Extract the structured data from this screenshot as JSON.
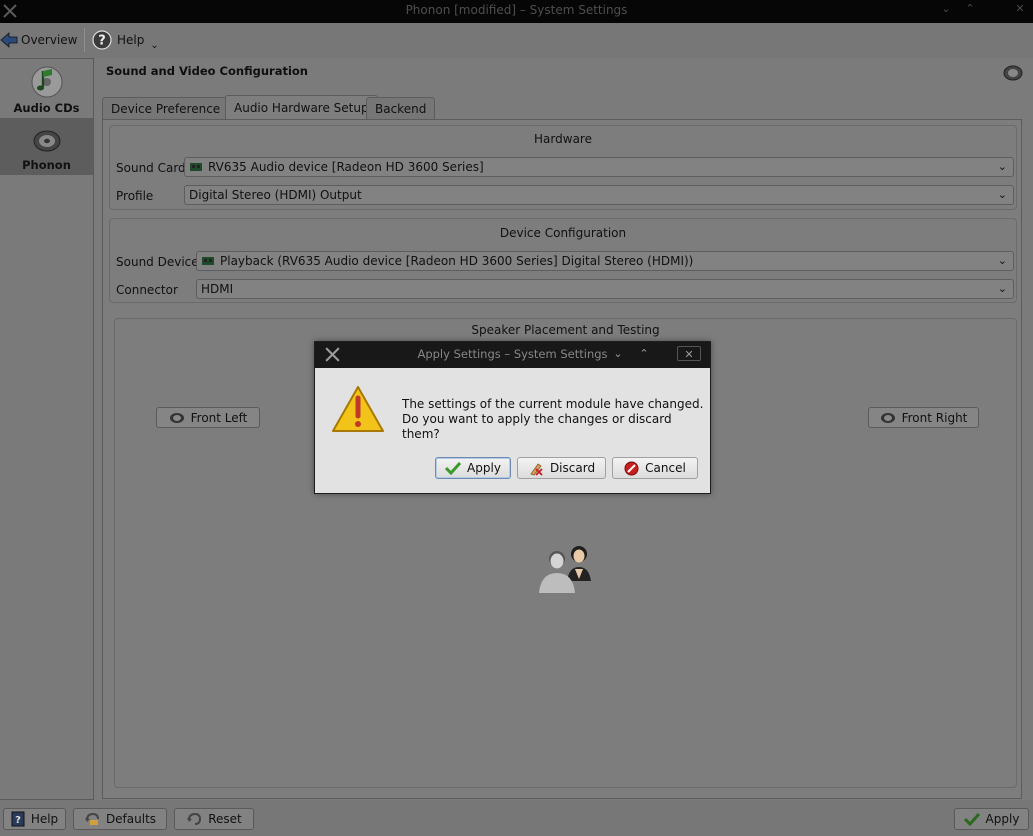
{
  "window": {
    "title": "Phonon [modified] – System Settings",
    "icon": "tools-icon",
    "controls": [
      "minimize-icon",
      "maximize-icon",
      "close-icon"
    ]
  },
  "toolbar": {
    "overview_label": "Overview",
    "help_label": "Help"
  },
  "sidebar": {
    "items": [
      {
        "label": "Audio CDs",
        "icon": "audio-cd-icon",
        "selected": false
      },
      {
        "label": "Phonon",
        "icon": "speaker-icon",
        "selected": true
      }
    ]
  },
  "module": {
    "title": "Sound and Video Configuration",
    "icon": "speaker-icon"
  },
  "tabs": [
    {
      "label": "Device Preference",
      "active": false
    },
    {
      "label": "Audio Hardware Setup",
      "active": true
    },
    {
      "label": "Backend",
      "active": false
    }
  ],
  "hardware": {
    "title": "Hardware",
    "sound_card_label": "Sound Card",
    "sound_card_value": "RV635 Audio device [Radeon HD 3600 Series]",
    "profile_label": "Profile",
    "profile_value": "Digital Stereo (HDMI) Output"
  },
  "device_config": {
    "title": "Device Configuration",
    "sound_device_label": "Sound Device",
    "sound_device_value": "Playback (RV635 Audio device [Radeon HD 3600 Series] Digital Stereo (HDMI))",
    "connector_label": "Connector",
    "connector_value": "HDMI"
  },
  "speaker": {
    "title": "Speaker Placement and Testing",
    "front_left": "Front Left",
    "front_right": "Front Right",
    "listener_icon": "users-icon"
  },
  "dialog": {
    "title": "Apply Settings – System Settings",
    "message_line1": "The settings of the current module have changed.",
    "message_line2": "Do you want to apply the changes or discard them?",
    "apply_label": "Apply",
    "discard_label": "Discard",
    "cancel_label": "Cancel",
    "icon": "warning-icon"
  },
  "bottombar": {
    "help_label": "Help",
    "defaults_label": "Defaults",
    "reset_label": "Reset",
    "apply_label": "Apply"
  },
  "colors": {
    "background": "#7b7b7b",
    "dialog_bg": "#e2e2e2",
    "warning_yellow": "#f2c318",
    "cancel_red": "#c81e1e",
    "apply_green": "#3a9a2a"
  }
}
